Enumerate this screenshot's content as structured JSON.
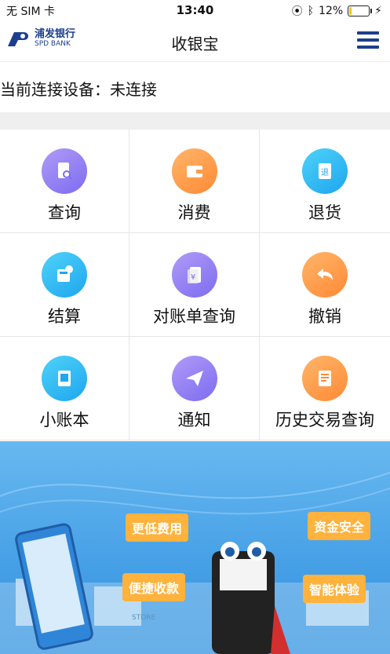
{
  "status": {
    "carrier": "无 SIM 卡",
    "time": "13:40",
    "battery": "12%",
    "battery_fraction": 0.12
  },
  "header": {
    "logo_cn": "浦发银行",
    "logo_en": "SPD BANK",
    "title": "收银宝",
    "menu_icon": "hamburger-icon"
  },
  "device": {
    "label": "当前连接设备：",
    "value": "未连接"
  },
  "grid": [
    {
      "label": "查询",
      "icon": "search-card-icon",
      "color": "#8f7ff4"
    },
    {
      "label": "消费",
      "icon": "wallet-icon",
      "color": "#ff9d4b"
    },
    {
      "label": "退货",
      "icon": "return-doc-icon",
      "color": "#2bb8f2"
    },
    {
      "label": "结算",
      "icon": "calculator-icon",
      "color": "#2bb8f2"
    },
    {
      "label": "对账单查询",
      "icon": "statement-icon",
      "color": "#8f7ff4"
    },
    {
      "label": "撤销",
      "icon": "undo-icon",
      "color": "#ff9d4b"
    },
    {
      "label": "小账本",
      "icon": "ledger-icon",
      "color": "#2bb8f2"
    },
    {
      "label": "通知",
      "icon": "paper-plane-icon",
      "color": "#8f7ff4"
    },
    {
      "label": "历史交易查询",
      "icon": "history-doc-icon",
      "color": "#ff9d4b"
    }
  ],
  "banner": {
    "tags": [
      "更低费用",
      "资金安全",
      "便捷收款",
      "智能体验"
    ],
    "store_sign": "STORE"
  }
}
